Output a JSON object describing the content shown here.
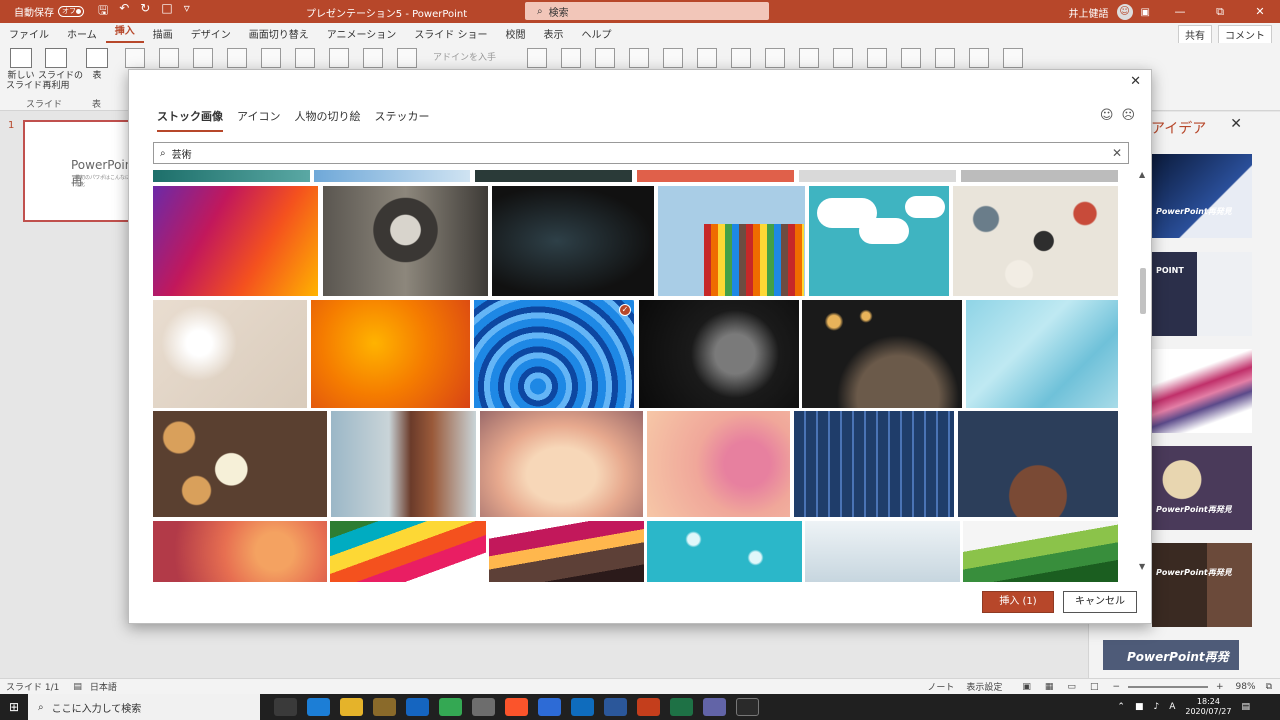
{
  "window": {
    "autosave_label": "自動保存",
    "autosave_state": "オフ",
    "doc_title": "プレゼンテーション5 - PowerPoint",
    "search_placeholder": "検索",
    "user_name": "井上健語"
  },
  "menu": {
    "tabs": [
      "ファイル",
      "ホーム",
      "挿入",
      "描画",
      "デザイン",
      "画面切り替え",
      "アニメーション",
      "スライド ショー",
      "校閲",
      "表示",
      "ヘルプ"
    ],
    "active_tab": "挿入",
    "share": "共有",
    "comment": "コメント"
  },
  "ribbon": {
    "new_slide": "新しい\nスライド",
    "reuse_slide": "スライドの\n再利用",
    "table": "表",
    "group_slide": "スライド",
    "group_table": "表",
    "addins": "アドインを入手"
  },
  "slides_pane": {
    "slide_number": "1",
    "thumb_title": "PowerPoint再",
    "thumb_sub": "最初のパワポはこんなに進化"
  },
  "designer": {
    "title": "アイデア",
    "idea1_label": "PowerPoint再発見",
    "idea2_label": "POINT",
    "idea5_label": "PowerPoint再発見",
    "idea6_label": "PowerPoint再発見",
    "idea7_label": "PowerPoint再発"
  },
  "dialog": {
    "tabs": [
      "ストック画像",
      "アイコン",
      "人物の切り絵",
      "ステッカー"
    ],
    "active_tab": "ストック画像",
    "search_value": "芸術",
    "insert_button": "挿入 (1)",
    "cancel_button": "キャンセル"
  },
  "status": {
    "slide_info": "スライド 1/1",
    "language": "日本語",
    "notes": "ノート",
    "display_settings": "表示設定",
    "zoom": "98%"
  },
  "taskbar": {
    "search_placeholder": "ここに入力して検索",
    "time": "18:24",
    "date": "2020/07/27"
  },
  "colors": {
    "accent": "#b7472a",
    "titlebar": "#b7472a"
  }
}
